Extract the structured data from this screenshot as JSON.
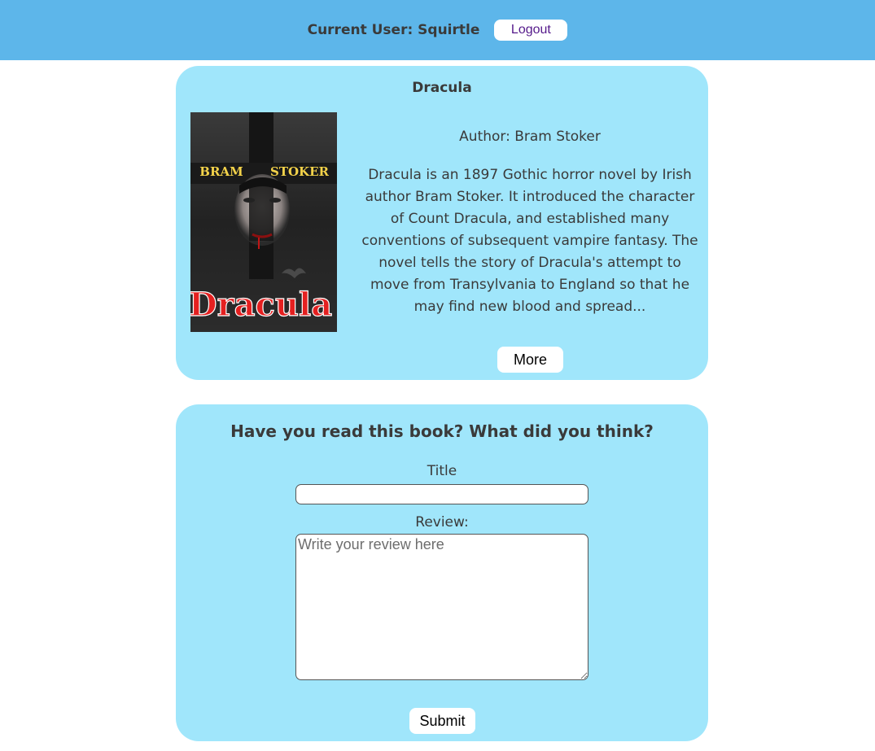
{
  "header": {
    "current_user": "Current User: Squirtle",
    "logout_label": "Logout",
    "background_color": "#5db6ea"
  },
  "book": {
    "title": "Dracula",
    "cover": {
      "author_first": "BRAM",
      "author_last": "STOKER",
      "title_text": "Dracula"
    },
    "author": "Author: Bram Stoker",
    "description": "Dracula is an 1897 Gothic horror novel by Irish author Bram Stoker. It introduced the character of Count Dracula, and established many conventions of subsequent vampire fantasy. The novel tells the story of Dracula's attempt to move from Transylvania to England so that he may find new blood and spread...",
    "more_label": "More",
    "card_color": "#a0e6fb"
  },
  "review_form": {
    "heading": "Have you read this book? What did you think?",
    "title_label": "Title",
    "title_value": "",
    "review_label": "Review:",
    "review_placeholder": "Write your review here",
    "submit_label": "Submit"
  }
}
